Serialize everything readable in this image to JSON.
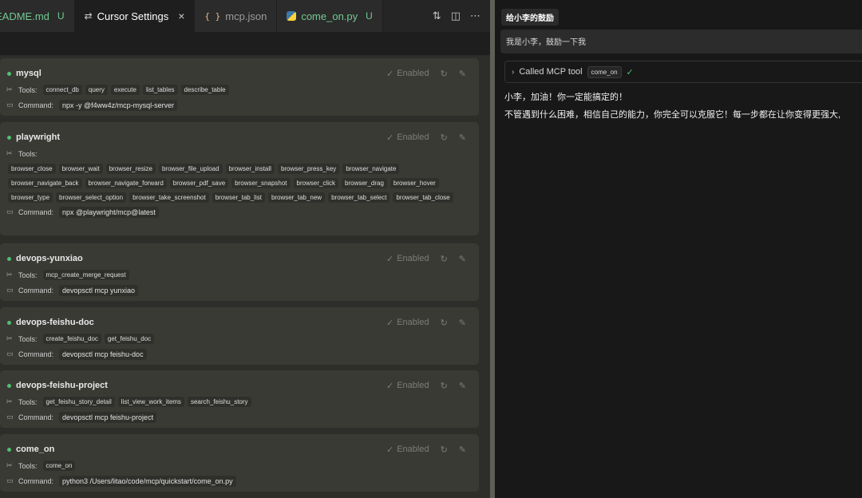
{
  "tabs": [
    {
      "label": "EADME.md",
      "status": "U",
      "icon": "markdown-icon"
    },
    {
      "label": "Cursor Settings",
      "status": "×",
      "icon": "settings-icon"
    },
    {
      "label": "mcp.json",
      "status": "",
      "icon": "json-icon"
    },
    {
      "label": "come_on.py",
      "status": "U",
      "icon": "python-icon"
    }
  ],
  "tab_actions": [
    "compare-icon",
    "split-editor-icon",
    "more-icon"
  ],
  "status_labels": {
    "tools": "Tools:",
    "command": "Command:",
    "enabled": "Enabled"
  },
  "servers": [
    {
      "name": "mysql",
      "tools": [
        "connect_db",
        "query",
        "execute",
        "list_tables",
        "describe_table"
      ],
      "command": "npx -y @f4ww4z/mcp-mysql-server"
    },
    {
      "name": "playwright",
      "tools": [
        "browser_close",
        "browser_wait",
        "browser_resize",
        "browser_file_upload",
        "browser_install",
        "browser_press_key",
        "browser_navigate",
        "browser_navigate_back",
        "browser_navigate_forward",
        "browser_pdf_save",
        "browser_snapshot",
        "browser_click",
        "browser_drag",
        "browser_hover",
        "browser_type",
        "browser_select_option",
        "browser_take_screenshot",
        "browser_tab_list",
        "browser_tab_new",
        "browser_tab_select",
        "browser_tab_close"
      ],
      "command": "npx @playwright/mcp@latest"
    },
    {
      "name": "devops-yunxiao",
      "tools": [
        "mcp_create_merge_request"
      ],
      "command": "devopsctl mcp yunxiao"
    },
    {
      "name": "devops-feishu-doc",
      "tools": [
        "create_feishu_doc",
        "get_feishu_doc"
      ],
      "command": "devopsctl mcp feishu-doc"
    },
    {
      "name": "devops-feishu-project",
      "tools": [
        "get_feishu_story_detail",
        "list_view_work_items",
        "search_feishu_story"
      ],
      "command": "devopsctl mcp feishu-project"
    },
    {
      "name": "come_on",
      "tools": [
        "come_on"
      ],
      "command": "python3 /Users/litao/code/mcp/quickstart/come_on.py"
    }
  ],
  "chat": {
    "title": "给小李的鼓励",
    "user_message": "我是小李，鼓励一下我",
    "tool_call_label": "Called MCP tool",
    "tool_name": "come_on",
    "reply_line1": "小李，加油！你一定能搞定的！",
    "reply_line2": "不管遇到什么困难，相信自己的能力，你完全可以克服它！每一步都在让你变得更强大,"
  }
}
